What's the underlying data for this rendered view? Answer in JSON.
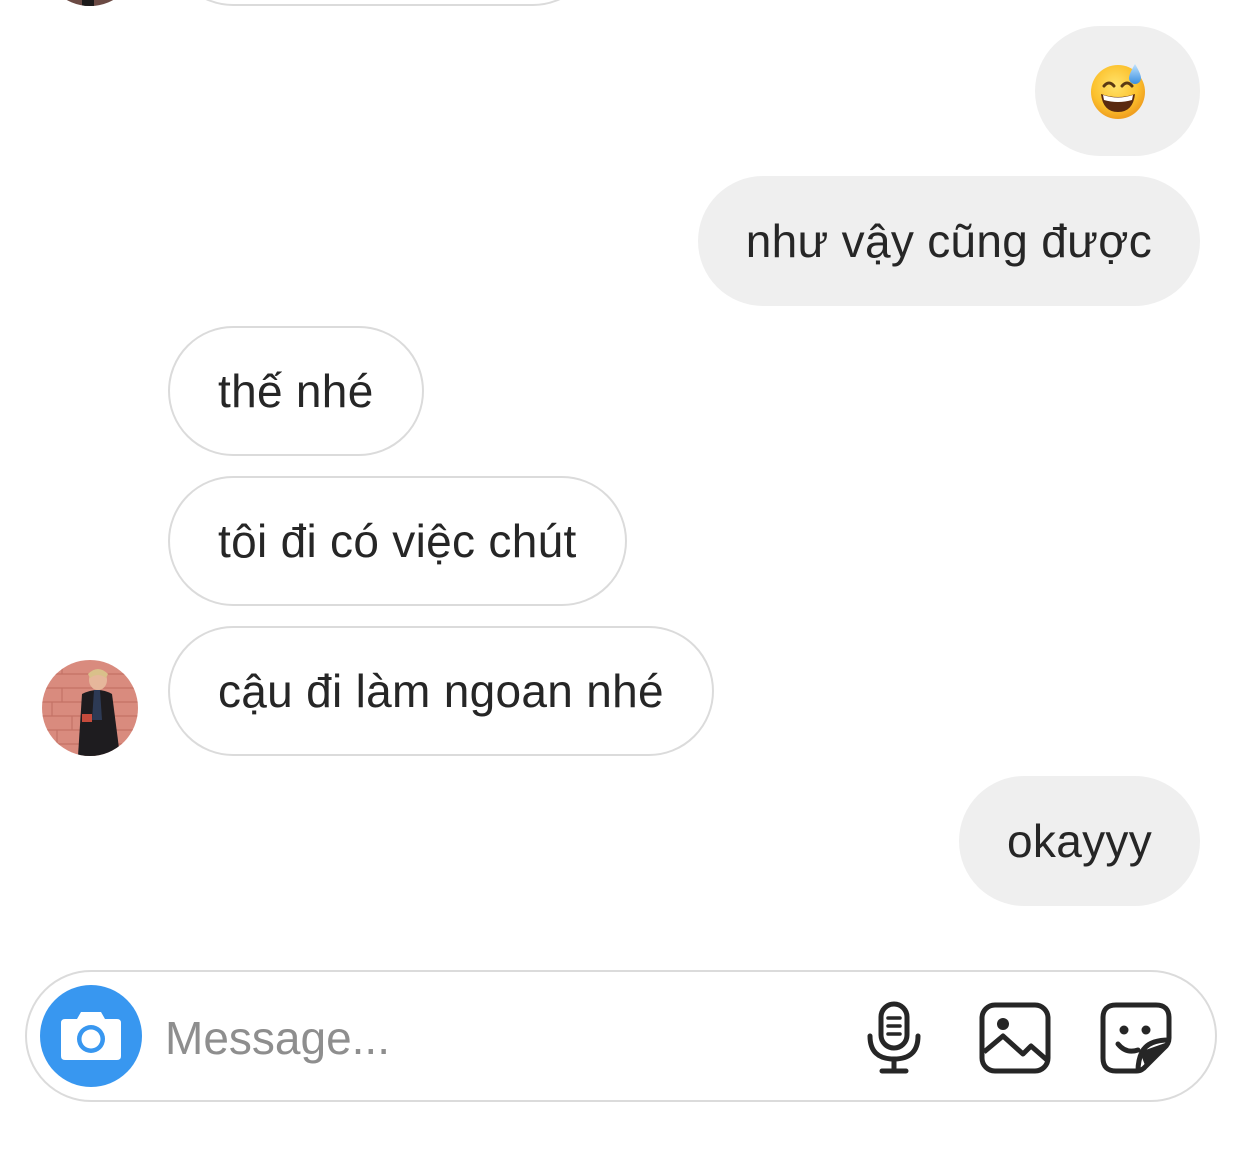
{
  "messages": [
    {
      "direction": "sent",
      "type": "emoji",
      "icon": "grinning-sweat-emoji"
    },
    {
      "direction": "sent",
      "type": "text",
      "text": "như vậy cũng được"
    },
    {
      "direction": "received",
      "type": "text",
      "text": "thế nhé"
    },
    {
      "direction": "received",
      "type": "text",
      "text": "tôi đi có việc chút"
    },
    {
      "direction": "received",
      "type": "text",
      "text": "cậu đi làm ngoan nhé"
    },
    {
      "direction": "sent",
      "type": "text",
      "text": "okayyy"
    }
  ],
  "composer": {
    "placeholder": "Message...",
    "icons": [
      "camera-icon",
      "microphone-icon",
      "gallery-icon",
      "sticker-icon"
    ]
  },
  "colors": {
    "sent_bubble": "#efefef",
    "received_border": "#dbdbdb",
    "camera_button": "#3897f0",
    "text": "#262626",
    "placeholder": "#8e8e8e"
  }
}
